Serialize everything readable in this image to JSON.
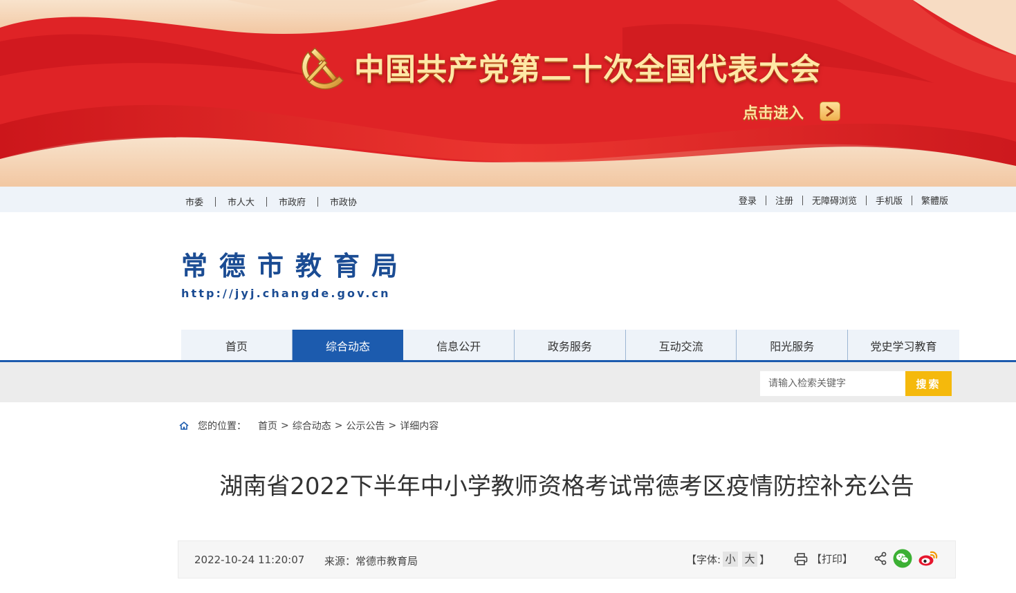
{
  "banner": {
    "title": "中国共产党第二十次全国代表大会",
    "enter_label": "点击进入"
  },
  "topbar": {
    "left_links": [
      "市委",
      "市人大",
      "市政府",
      "市政协"
    ],
    "right_links": [
      "登录",
      "注册",
      "无障碍浏览",
      "手机版",
      "繁體版"
    ]
  },
  "logo": {
    "name": "常德市教育局",
    "url": "http://jyj.changde.gov.cn"
  },
  "nav": {
    "items": [
      "首页",
      "综合动态",
      "信息公开",
      "政务服务",
      "互动交流",
      "阳光服务",
      "党史学习教育"
    ],
    "active_index": 1
  },
  "search": {
    "placeholder": "请输入检索关键字",
    "button_label": "搜索"
  },
  "breadcrumb": {
    "prefix": "您的位置：",
    "items": [
      "首页",
      "综合动态",
      "公示公告",
      "详细内容"
    ]
  },
  "article": {
    "title": "湖南省2022下半年中小学教师资格考试常德考区疫情防控补充公告",
    "date": "2022-10-24 11:20:07",
    "source": "来源：常德市教育局",
    "font_label": "【字体:",
    "font_small": "小",
    "font_large": "大",
    "font_close": "】",
    "print_label": "【打印】"
  },
  "colors": {
    "primary_blue": "#1c5bae",
    "logo_blue": "#1b4c93",
    "search_button": "#f5b90c",
    "banner_red": "#d81e22"
  },
  "icons": [
    "emblem-icon",
    "arrow-right-icon",
    "home-icon",
    "printer-icon",
    "share-icon",
    "wechat-icon",
    "weibo-icon"
  ]
}
